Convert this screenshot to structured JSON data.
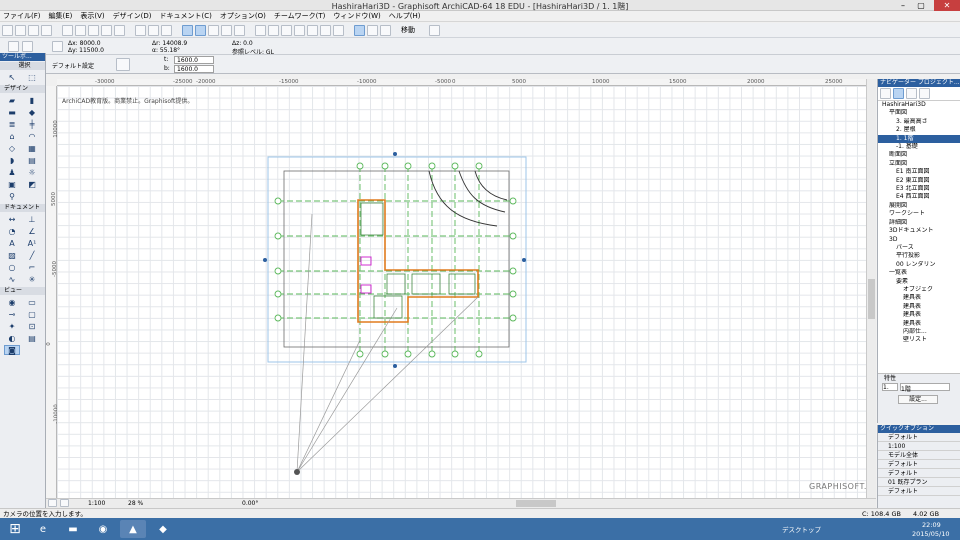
{
  "window": {
    "title": "HashiraHari3D - Graphisoft ArchiCAD-64 18 EDU - [HashiraHari3D / 1. 1階]"
  },
  "menu": [
    "ファイル(F)",
    "編集(E)",
    "表示(V)",
    "デザイン(D)",
    "ドキュメント(C)",
    "オプション(O)",
    "チームワーク(T)",
    "ウィンドウ(W)",
    "ヘルプ(H)"
  ],
  "info": {
    "dx": "Δx: 8000.0",
    "dy": "Δy: 11500.0",
    "dr": "Δr: 14008.9",
    "da": "α: 55.18°",
    "dz": "Δz: 0.0",
    "story": "参照レベル: GL"
  },
  "toolbar": {
    "move_label": "移動"
  },
  "props": {
    "default": "デフォルト設定",
    "t_label": "t:",
    "t_value": "1600.0",
    "b_label": "b:",
    "b_value": "1600.0"
  },
  "palette": {
    "title": "ツールボ...",
    "select": "選択",
    "design": "デザイン",
    "document": "ドキュメント",
    "view": "ビュー"
  },
  "canvas": {
    "note": "ArchiCAD教育版。商業禁止。Graphisoft提供。",
    "logo": "GRAPHISOFT."
  },
  "ruler_top": [
    "-30000",
    "-25000",
    "-20000",
    "-15000",
    "-10000",
    "-5000",
    "0",
    "5000",
    "10000",
    "15000",
    "20000",
    "25000",
    "30000",
    "35000",
    "40000",
    "45000",
    "50000",
    "55000",
    "60000",
    "65000"
  ],
  "ruler_left": [
    "10000",
    "5000",
    "0",
    "-5000",
    "-10000",
    "-15000",
    "-20000",
    "-25000"
  ],
  "nav": {
    "title": "ナビゲーター プロジェクト...",
    "tree": [
      {
        "l": "HashiraHari3D",
        "d": 0
      },
      {
        "l": "平面図",
        "d": 1
      },
      {
        "l": "3. 最高高さ",
        "d": 2
      },
      {
        "l": "2. 屋根",
        "d": 2
      },
      {
        "l": "1. 1階",
        "d": 2,
        "sel": true
      },
      {
        "l": "-1. 基礎",
        "d": 2
      },
      {
        "l": "断面図",
        "d": 1
      },
      {
        "l": "立面図",
        "d": 1
      },
      {
        "l": "E1 南立面図",
        "d": 2
      },
      {
        "l": "E2 東立面図",
        "d": 2
      },
      {
        "l": "E3 北立面図",
        "d": 2
      },
      {
        "l": "E4 西立面図",
        "d": 2
      },
      {
        "l": "展開図",
        "d": 1
      },
      {
        "l": "ワークシート",
        "d": 1
      },
      {
        "l": "詳細図",
        "d": 1
      },
      {
        "l": "3Dドキュメント",
        "d": 1
      },
      {
        "l": "3D",
        "d": 1
      },
      {
        "l": "パース",
        "d": 2
      },
      {
        "l": "平行投影",
        "d": 2
      },
      {
        "l": "00 レンダリン",
        "d": 2
      },
      {
        "l": "一覧表",
        "d": 1
      },
      {
        "l": "要素",
        "d": 2
      },
      {
        "l": "オブジェク",
        "d": 3
      },
      {
        "l": "建具表",
        "d": 3
      },
      {
        "l": "建具表",
        "d": 3
      },
      {
        "l": "建具表",
        "d": 3
      },
      {
        "l": "建具表",
        "d": 3
      },
      {
        "l": "内部仕...",
        "d": 3
      },
      {
        "l": "壁リスト",
        "d": 3
      }
    ],
    "props_label": "特性",
    "story_num": "1.",
    "story_name": "1階",
    "settings": "設定..."
  },
  "quick": {
    "title": "クイックオプション",
    "rows": [
      "デフォルト",
      "1:100",
      "モデル全体",
      "デフォルト",
      "デフォルト",
      "01 既存プラン",
      "デフォルト"
    ]
  },
  "hscroll": {
    "scale": "1:100",
    "zoom": "28 %",
    "angle": "0.00°"
  },
  "status": {
    "prompt": "カメラの位置を入力します。",
    "disk": "C: 108.4 GB",
    "mem": "4.02 GB"
  },
  "taskbar": {
    "desktop": "デスクトップ",
    "time": "22:09",
    "date": "2015/05/10"
  }
}
